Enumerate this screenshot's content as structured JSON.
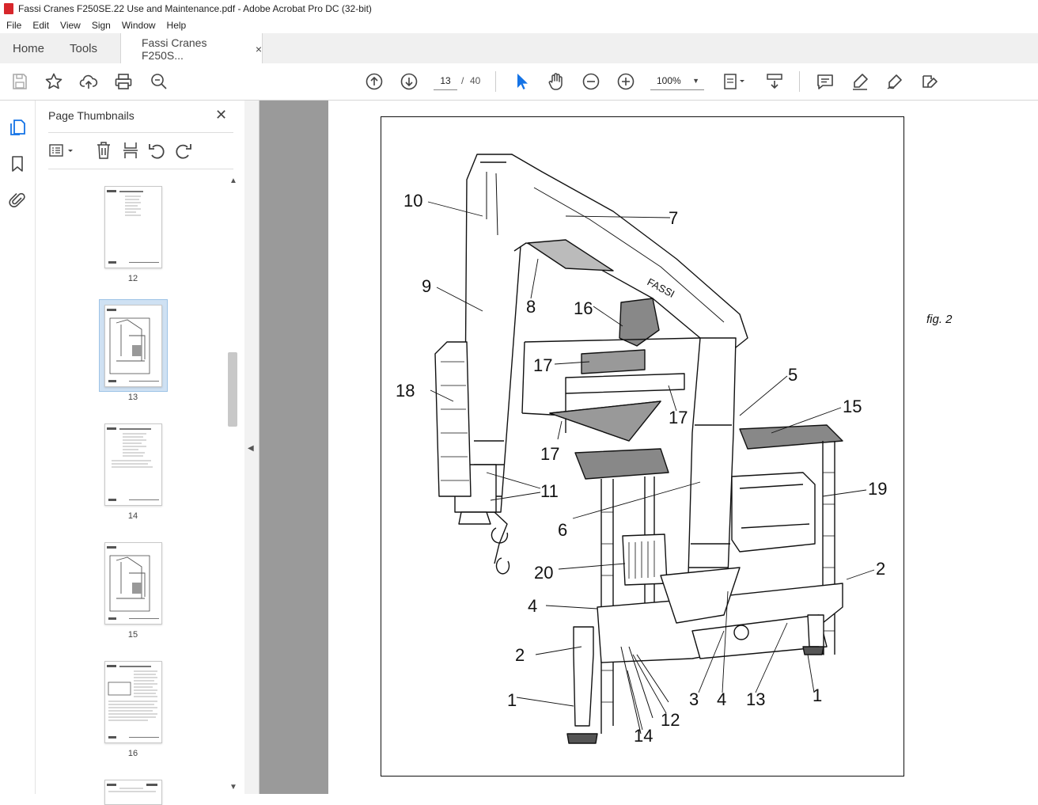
{
  "window": {
    "title": "Fassi Cranes F250SE.22 Use and Maintenance.pdf - Adobe Acrobat Pro DC (32-bit)"
  },
  "menu": [
    "File",
    "Edit",
    "View",
    "Sign",
    "Window",
    "Help"
  ],
  "tabs": {
    "home": "Home",
    "tools": "Tools",
    "doc": "Fassi Cranes F250S...",
    "close": "×"
  },
  "toolbar": {
    "page_current": "13",
    "page_sep": "/",
    "page_total": "40",
    "zoom": "100%"
  },
  "panel": {
    "title": "Page Thumbnails",
    "close": "✕"
  },
  "thumbnails": [
    {
      "label": "12",
      "kind": "list"
    },
    {
      "label": "13",
      "kind": "figure",
      "selected": true
    },
    {
      "label": "14",
      "kind": "list"
    },
    {
      "label": "15",
      "kind": "figure"
    },
    {
      "label": "16",
      "kind": "text"
    },
    {
      "label": "",
      "kind": "text"
    }
  ],
  "page": {
    "caption": "fig. 2",
    "brand": "FASSI",
    "callouts": [
      "10",
      "7",
      "9",
      "8",
      "16",
      "17",
      "18",
      "5",
      "15",
      "17",
      "17",
      "11",
      "19",
      "6",
      "20",
      "2",
      "4",
      "2",
      "3",
      "4",
      "13",
      "1",
      "1",
      "12",
      "14"
    ]
  },
  "colors": {
    "accent": "#1473e6",
    "pdf_red": "#d7262b",
    "selected_thumb": "#9dc3e6"
  }
}
